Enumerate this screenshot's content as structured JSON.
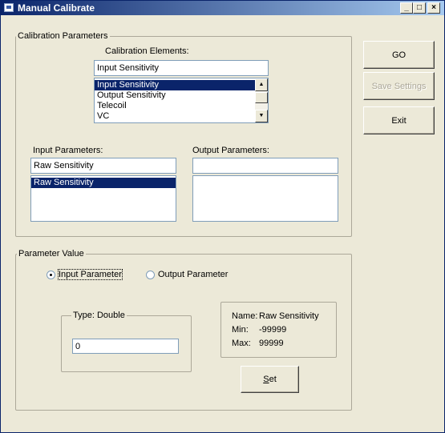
{
  "window": {
    "title": "Manual Calibrate",
    "min_glyph": "_",
    "max_glyph": "□",
    "close_glyph": "×"
  },
  "calibration_parameters": {
    "legend": "Calibration Parameters",
    "elements_label": "Calibration Elements:",
    "elements_value": "Input Sensitivity",
    "elements_list": [
      "Input Sensitivity",
      "Output Sensitivity",
      "Telecoil",
      "VC"
    ],
    "selected_index": 0,
    "input_label": "Input Parameters:",
    "input_value": "Raw Sensitivity",
    "input_list": [
      "Raw Sensitivity"
    ],
    "output_label": "Output Parameters:",
    "output_value": "",
    "output_list": []
  },
  "buttons": {
    "go": "GO",
    "save_settings": "Save Settings",
    "exit": "Exit",
    "set_mnemonic": "S",
    "set_rest": "et"
  },
  "parameter_value": {
    "legend": "Parameter Value",
    "radio_input": "Input Parameter",
    "radio_output": "Output Parameter",
    "selected_radio": "input",
    "type_legend": "Type: Double",
    "type_value": "0",
    "info_name_label": "Name:",
    "info_name": "Raw Sensitivity",
    "info_min_label": "Min:",
    "info_min": "-99999",
    "info_max_label": "Max:",
    "info_max": "99999"
  },
  "colors": {
    "title_gradient_start": "#0a246a",
    "selection": "#0a246a",
    "face": "#ece9d8"
  }
}
